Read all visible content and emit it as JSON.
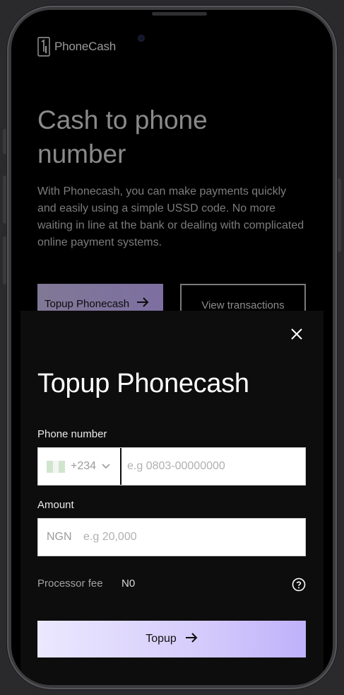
{
  "brand": {
    "name": "PhoneCash"
  },
  "hero": {
    "title": "Cash to phone number",
    "description": "With Phonecash, you can make payments quickly and easily using a simple USSD code. No more waiting in line at the bank or dealing with complicated online payment systems.",
    "primary_button": "Topup Phonecash",
    "secondary_button": "View transactions"
  },
  "modal": {
    "title": "Topup Phonecash",
    "phone": {
      "label": "Phone number",
      "dial_code": "+234",
      "placeholder": "e.g 0803-00000000",
      "value": ""
    },
    "amount": {
      "label": "Amount",
      "currency": "NGN",
      "placeholder": "e.g 20,000",
      "value": ""
    },
    "fee": {
      "label": "Processor fee",
      "value": "N0"
    },
    "submit_label": "Topup"
  },
  "colors": {
    "accent": "#c4b5fd",
    "sheet_bg": "#0d0d0e",
    "flag_green": "#008751"
  },
  "icons": {
    "close": "close-icon",
    "arrow": "arrow-right-icon",
    "chevron": "chevron-down-icon",
    "help": "question-circle-icon",
    "flag": "nigeria-flag-icon"
  }
}
